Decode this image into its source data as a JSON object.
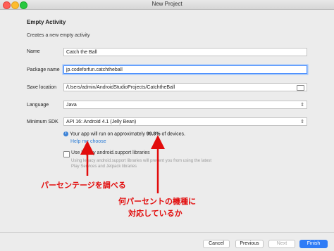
{
  "window": {
    "title": "New Project"
  },
  "header": {
    "title": "Empty Activity",
    "subtitle": "Creates a new empty activity"
  },
  "form": {
    "name": {
      "label": "Name",
      "value": "Catch the Ball"
    },
    "package": {
      "label": "Package name",
      "value": "jp.codeforfun.catchtheball"
    },
    "save_location": {
      "label": "Save location",
      "value": "/Users/admin/AndroidStudioProjects/CatchtheBall"
    },
    "language": {
      "label": "Language",
      "value": "Java"
    },
    "min_sdk": {
      "label": "Minimum SDK",
      "value": "API 16: Android 4.1 (Jelly Bean)"
    }
  },
  "info": {
    "text_before": "Your app will run on approximately ",
    "percentage": "99.8%",
    "text_after": " of devices.",
    "help_link": "Help me choose"
  },
  "legacy": {
    "label": "Use legacy android.support libraries",
    "description": "Using legacy android.support libraries will prevent you from using the latest Play Services and Jetpack libraries"
  },
  "annotations": {
    "percentage_note": "パーセンテージを調べる",
    "device_note_line1": "何パーセントの機種に",
    "device_note_line2": "対応しているか"
  },
  "footer": {
    "cancel": "Cancel",
    "previous": "Previous",
    "next": "Next",
    "finish": "Finish"
  },
  "colors": {
    "accent": "#2f7cf6",
    "annotation": "#e20c0c",
    "link": "#2a7bd6"
  }
}
